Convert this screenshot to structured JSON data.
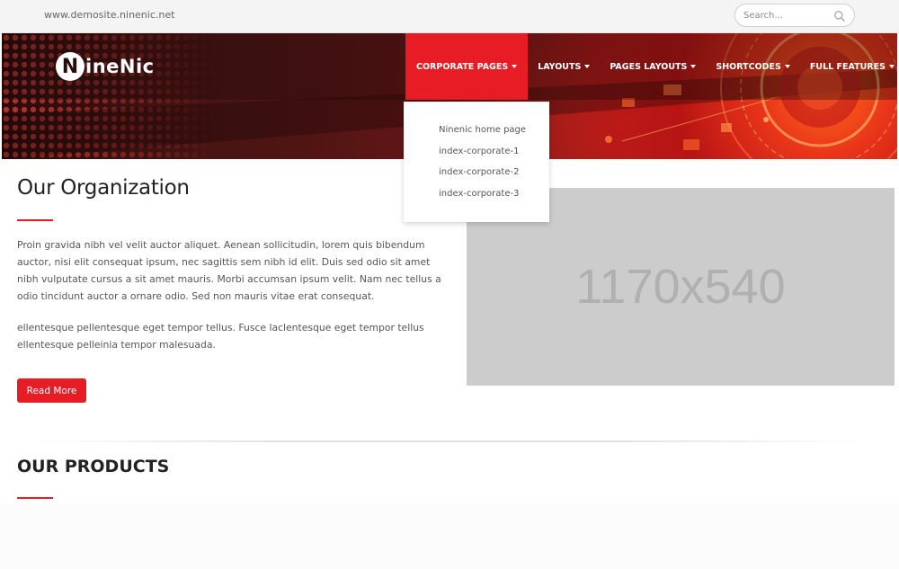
{
  "topbar": {
    "site_url": "www.demosite.ninenic.net",
    "search_placeholder": "Search...",
    "search_icon": "search-icon"
  },
  "logo": {
    "initial": "N",
    "rest": "ineNic"
  },
  "nav": {
    "items": [
      {
        "label": "CORPORATE PAGES",
        "active": true
      },
      {
        "label": "LAYOUTS",
        "active": false
      },
      {
        "label": "PAGES LAYOUTS",
        "active": false
      },
      {
        "label": "SHORTCODES",
        "active": false
      },
      {
        "label": "FULL FEATURES",
        "active": false
      }
    ]
  },
  "dropdown": {
    "items": [
      "Ninenic home page",
      "index-corporate-1",
      "index-corporate-2",
      "index-corporate-3"
    ]
  },
  "organization": {
    "title": "Our Organization",
    "paragraph1": "Proin gravida nibh vel velit auctor aliquet. Aenean sollicitudin, lorem quis bibendum auctor, nisi elit consequat ipsum, nec sagittis sem nibh id elit. Duis sed odio sit amet nibh vulputate cursus a sit amet mauris. Morbi accumsan ipsum velit. Nam nec tellus a odio tincidunt auctor a ornare odio. Sed non mauris vitae erat consequat.",
    "paragraph2": "ellentesque pellentesque eget tempor tellus. Fusce laclentesque eget tempor tellus ellentesque pelleinia tempor malesuada.",
    "button_label": "Read More",
    "image_placeholder": "1170x540"
  },
  "products": {
    "title_bold": "OUR",
    "title_rest": "PRODUCTS"
  },
  "colors": {
    "accent": "#e81c24",
    "placeholder_bg": "#cccccc",
    "topbar_bg": "#f4f4f4"
  }
}
